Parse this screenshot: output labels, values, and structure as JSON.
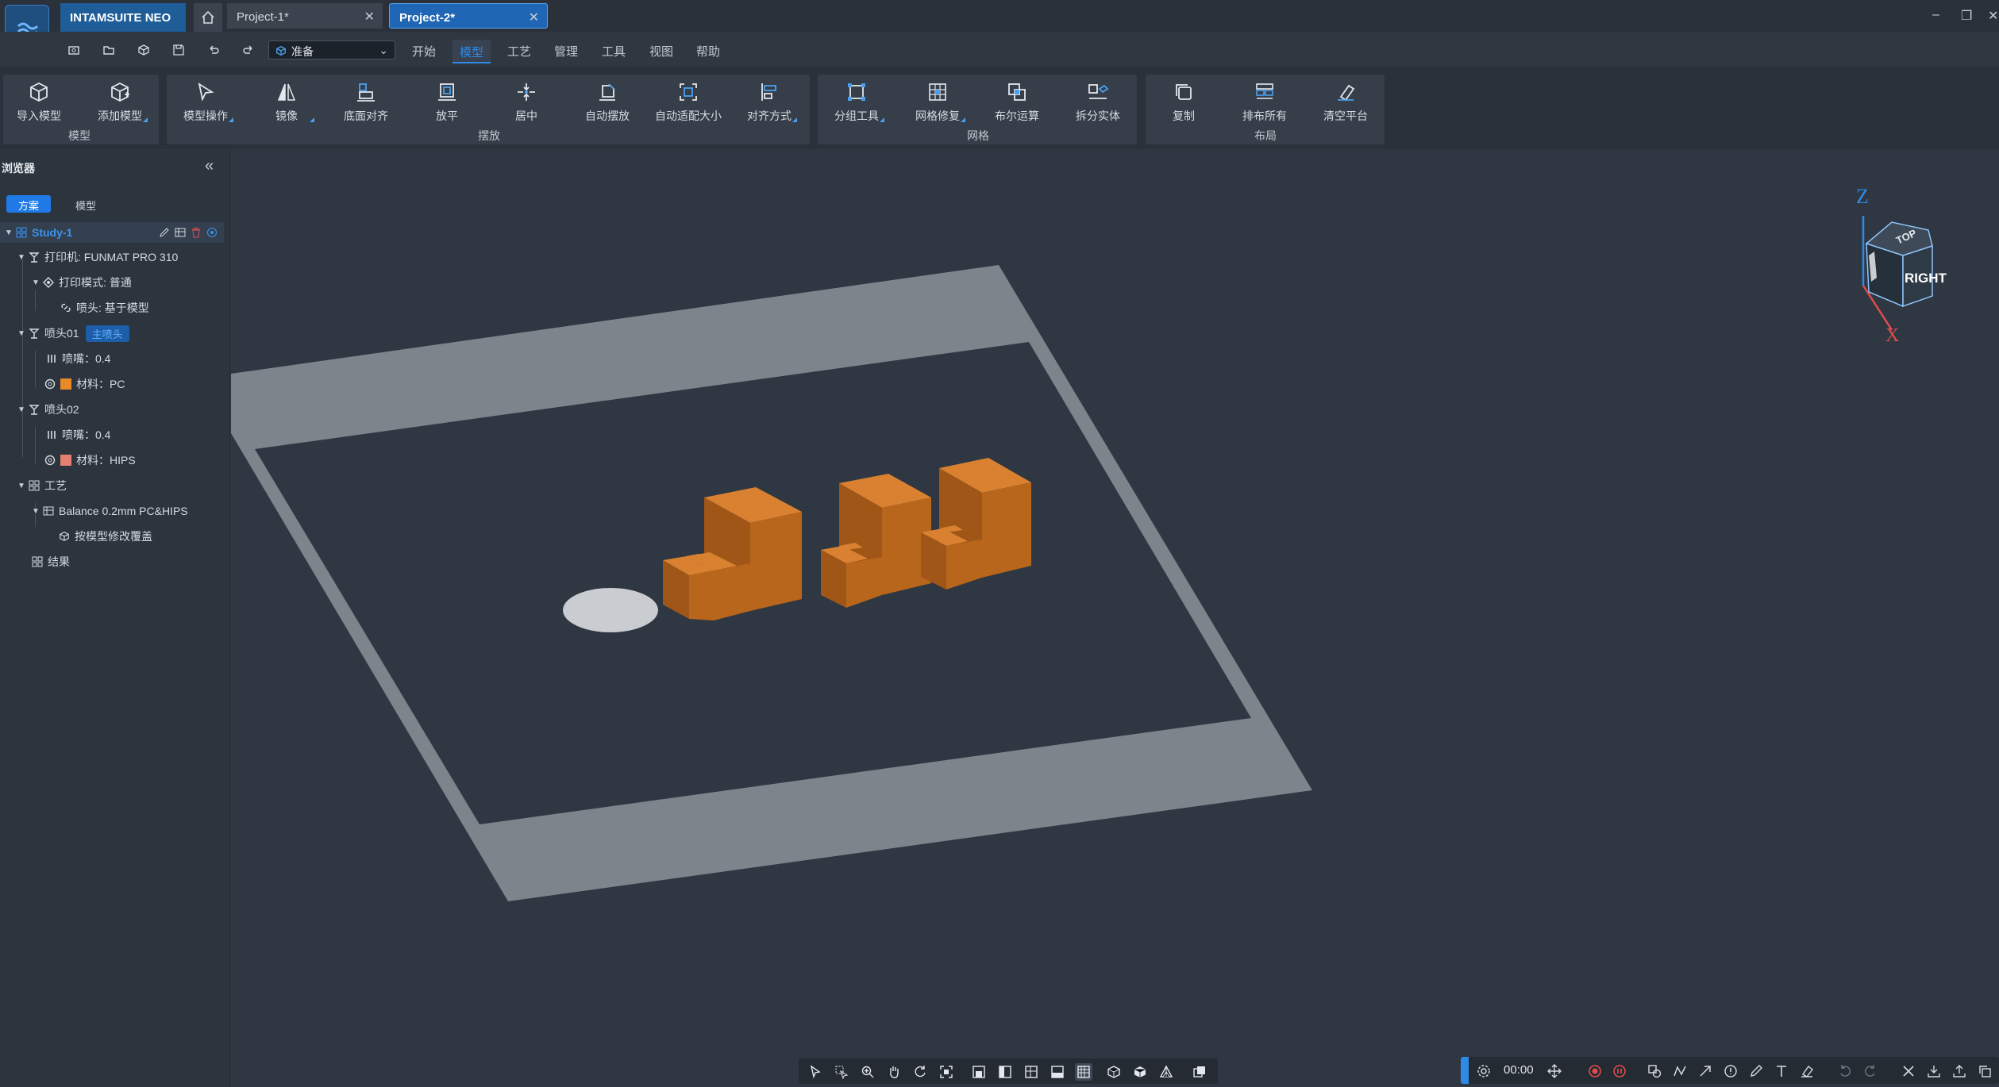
{
  "app": {
    "name": "INTAMSUITE NEO",
    "tabs": [
      {
        "label": "Project-1*",
        "active": false
      },
      {
        "label": "Project-2*",
        "active": true
      }
    ],
    "window_controls": [
      "–",
      "❐",
      "✕"
    ]
  },
  "quickbar": {
    "icons": [
      "new-icon",
      "open-folder-icon",
      "cube-icon",
      "save-icon",
      "undo-icon",
      "redo-icon"
    ],
    "stage_select": {
      "value": "准备"
    }
  },
  "menu_tabs": [
    "开始",
    "模型",
    "工艺",
    "管理",
    "工具",
    "视图",
    "帮助"
  ],
  "ribbon": {
    "groups": [
      {
        "label": "模型",
        "buttons": [
          "导入模型",
          "添加模型"
        ]
      },
      {
        "label": "摆放",
        "buttons": [
          "模型操作",
          "镜像",
          "底面对齐",
          "放平",
          "居中",
          "自动摆放",
          "自动适配大小",
          "对齐方式"
        ]
      },
      {
        "label": "网格",
        "buttons": [
          "分组工具",
          "网格修复",
          "布尔运算",
          "拆分实体"
        ]
      },
      {
        "label": "布局",
        "buttons": [
          "复制",
          "排布所有",
          "清空平台"
        ]
      }
    ]
  },
  "browser": {
    "title": "浏览器",
    "segments": [
      "方案",
      "模型"
    ],
    "tree": {
      "study": "Study-1",
      "printer": "打印机: FUNMAT PRO 310",
      "print_mode": "打印模式: 普通",
      "nozzle_mode": "喷头: 基于模型",
      "head1": "喷头01",
      "head1_badge": "主喷头",
      "head1_nozzle": "喷嘴：0.4",
      "head1_material": "材料：PC",
      "head2": "喷头02",
      "head2_nozzle": "喷嘴：0.4",
      "head2_material": "材料：HIPS",
      "process": "工艺",
      "profile": "Balance 0.2mm PC&HIPS",
      "override": "按模型修改覆盖",
      "results": "结果"
    },
    "colors": {
      "pc": "#e8892a",
      "hips": "#e58070"
    }
  },
  "viewport": {
    "view_cube": {
      "face": "RIGHT",
      "top": "TOP",
      "axis_z": "Z",
      "axis_x": "X"
    },
    "colors": {
      "plate": "#7d848c",
      "plate_inner": "#2f3742",
      "part_top": "#d98130",
      "part_side": "#b8661c",
      "part_front": "#9f5616"
    }
  },
  "view_toolbar": {
    "icons": [
      "select-icon",
      "box-select-icon",
      "zoom-icon",
      "pan-hand-icon",
      "rotate-icon",
      "fit-icon",
      "view-front-icon",
      "view-left-icon",
      "view-right-icon",
      "view-bottom-icon",
      "view-back-icon",
      "shaded-icon",
      "wireframe-icon",
      "perspective-icon",
      "layers-icon"
    ]
  },
  "anno_toolbar": {
    "timer": "00:00",
    "icons": [
      "settings-icon",
      "move-icon",
      "record-icon",
      "pause-icon",
      "shapes-icon",
      "polyline-icon",
      "arrow-icon",
      "info-icon",
      "pen-icon",
      "text-icon",
      "eraser-icon",
      "undo-icon",
      "redo-icon",
      "close-icon",
      "download-icon",
      "export-icon",
      "copy-icon"
    ]
  }
}
